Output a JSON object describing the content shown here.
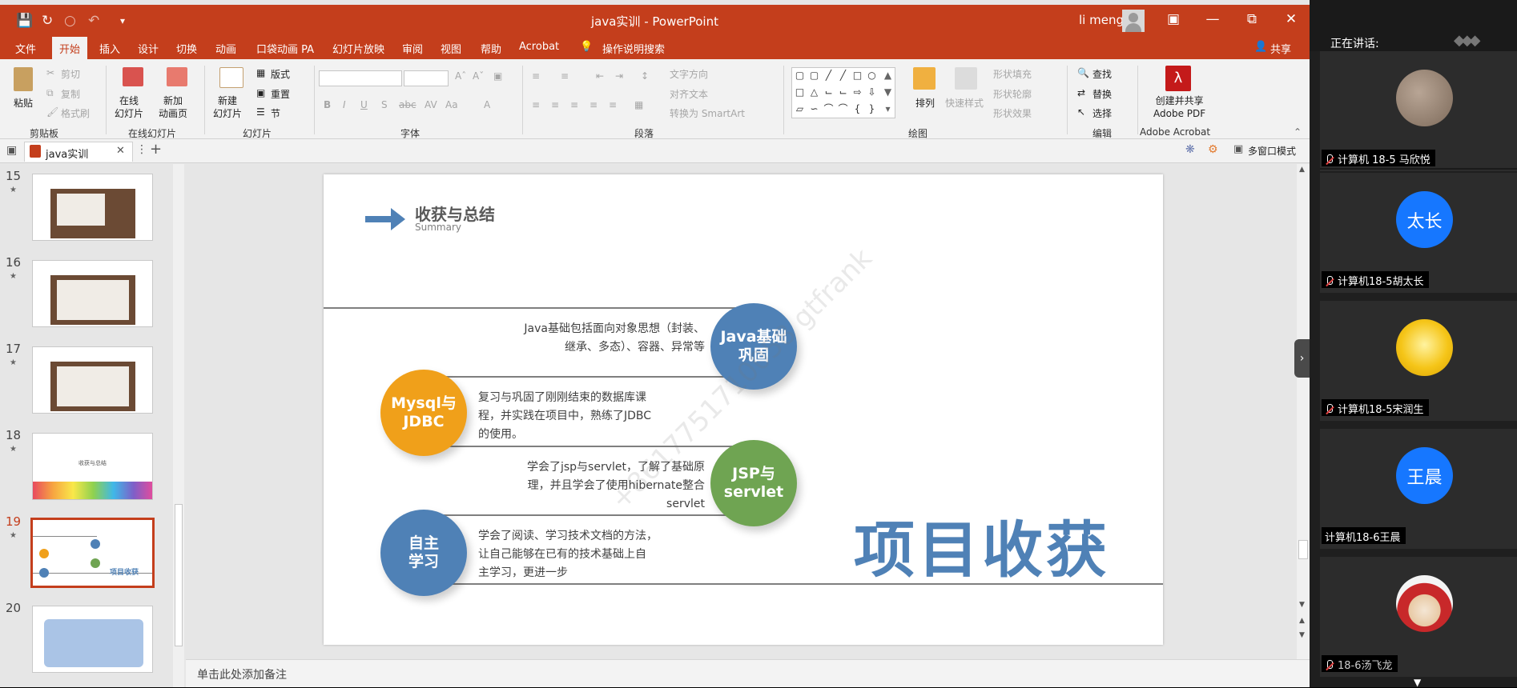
{
  "window": {
    "title": "java实训  -  PowerPoint",
    "user": "li meng"
  },
  "menu": {
    "items": [
      "文件",
      "开始",
      "插入",
      "设计",
      "切换",
      "动画",
      "口袋动画 PA",
      "幻灯片放映",
      "审阅",
      "视图",
      "帮助",
      "Acrobat",
      "操作说明搜索"
    ],
    "share": "共享"
  },
  "ribbon": {
    "paste": "粘贴",
    "cut": "剪切",
    "copy": "复制",
    "format_painter": "格式刷",
    "clipboard": "剪贴板",
    "online_slide": "在线\n幻灯片",
    "new_anim_page": "新加\n动画页",
    "online_slides_group": "在线幻灯片",
    "new_slide": "新建\n幻灯片",
    "layout": "版式",
    "reset": "重置",
    "section": "节",
    "slides_group": "幻灯片",
    "font_group": "字体",
    "paragraph_group": "段落",
    "text_direction": "文字方向",
    "align_text": "对齐文本",
    "smartart": "转换为 SmartArt",
    "arrange": "排列",
    "quick_styles": "快速样式",
    "shape_fill": "形状填充",
    "shape_outline": "形状轮廓",
    "shape_effects": "形状效果",
    "drawing_group": "绘图",
    "find": "查找",
    "replace": "替换",
    "select": "选择",
    "editing_group": "编辑",
    "create_pdf": "创建并共享\nAdobe PDF",
    "acrobat_group": "Adobe Acrobat"
  },
  "tabs": {
    "doc": "java实训",
    "multiwindow": "多窗口模式"
  },
  "thumbnails": [
    {
      "num": "15",
      "title": ""
    },
    {
      "num": "16",
      "title": ""
    },
    {
      "num": "17",
      "title": ""
    },
    {
      "num": "18",
      "title": "收获与总结"
    },
    {
      "num": "19",
      "title": "项目收获"
    },
    {
      "num": "20",
      "title": ""
    }
  ],
  "slide": {
    "title": "收获与总结",
    "subtitle": "Summary",
    "big_title": "项目收获",
    "watermark": "+8617751710058 gtfrank",
    "items": [
      {
        "circle": "Java基础\n巩固",
        "color": "#4f81b6",
        "text": "Java基础包括面向对象思想（封装、\n继承、多态）、容器、异常等"
      },
      {
        "circle": "Mysql与\nJDBC",
        "color": "#f0a01a",
        "text": "复习与巩固了刚刚结束的数据库课\n程，并实践在项目中，熟练了JDBC\n的使用。"
      },
      {
        "circle": "JSP与\nservlet",
        "color": "#6fa452",
        "text": "学会了jsp与servlet，了解了基础原\n理，并且学会了使用hibernate整合\nservlet"
      },
      {
        "circle": "自主\n学习",
        "color": "#4f81b6",
        "text": "学会了阅读、学习技术文档的方法，\n让自己能够在已有的技术基础上自\n主学习，更进一步"
      }
    ]
  },
  "notes": {
    "placeholder": "单击此处添加备注"
  },
  "meeting": {
    "speaking_label": "正在讲话:",
    "participants": [
      {
        "name": "计算机 18-5 马欣悦",
        "avatar_text": "",
        "avatar_color": "#a08c7a",
        "muted": true
      },
      {
        "name": "计算机18-5胡太长",
        "avatar_text": "太长",
        "avatar_color": "#1677ff",
        "muted": true
      },
      {
        "name": "计算机18-5宋润生",
        "avatar_text": "",
        "avatar_color": "#f5c518",
        "muted": true
      },
      {
        "name": "计算机18-6王晨",
        "avatar_text": "王晨",
        "avatar_color": "#1677ff",
        "muted": false
      },
      {
        "name": "18-6汤飞龙",
        "avatar_text": "",
        "avatar_color": "#c8282a",
        "muted": true
      }
    ]
  }
}
